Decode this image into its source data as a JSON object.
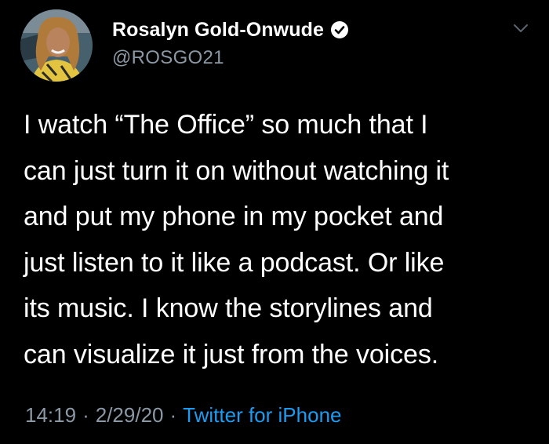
{
  "author": {
    "display_name": "Rosalyn Gold-Onwude",
    "handle": "@ROSGO21",
    "verified": true,
    "avatar_icon": "profile-photo"
  },
  "tweet": {
    "text_lines": [
      "I watch “The Office” so much that I",
      "can just turn it on without watching it",
      "and put my phone in my pocket and",
      "just listen to it like a podcast. Or like",
      "its music. I know the storylines and",
      "can visualize it just from the voices."
    ],
    "time": "14:19",
    "date": "2/29/20",
    "separator": "·",
    "source": "Twitter for iPhone"
  },
  "icons": {
    "verified": "verified-badge-icon",
    "menu": "chevron-down-icon"
  },
  "colors": {
    "background": "#000000",
    "text": "#ffffff",
    "secondary": "#8b98a5",
    "link": "#1d9bf0"
  }
}
